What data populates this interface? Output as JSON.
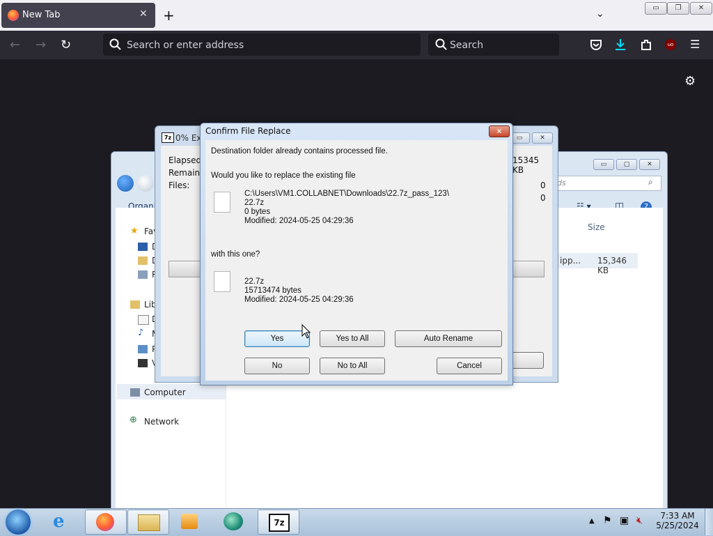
{
  "browser": {
    "tab_title": "New Tab",
    "tab_close": "✕",
    "new_tab": "+",
    "tab_list": "⌄",
    "url_placeholder": "Search or enter address",
    "search_placeholder": "Search",
    "window_buttons": [
      "▭",
      "❐",
      "✕"
    ]
  },
  "explorer": {
    "organize": "Organiz",
    "search_placeholder": "ds",
    "size_header": "Size",
    "file_partial": "ipp...",
    "file_size": "15,346 KB",
    "sidebar": [
      {
        "label": "Fav"
      },
      {
        "label": "D"
      },
      {
        "label": "D"
      },
      {
        "label": "R"
      },
      {
        "label": "Lib"
      },
      {
        "label": "D"
      },
      {
        "label": "M"
      },
      {
        "label": "P"
      },
      {
        "label": "V"
      },
      {
        "label": "Computer"
      },
      {
        "label": "Network"
      }
    ]
  },
  "sevenzip": {
    "title": "0% Ext",
    "elapsed_label": "Elapsed ti",
    "remaining_label": "Remaining",
    "files_label": "Files:",
    "size_value": "15345 KB",
    "value1": "0",
    "value2": "0"
  },
  "dialog": {
    "title": "Confirm File Replace",
    "close": "✕",
    "msg1": "Destination folder already contains processed file.",
    "msg2": "Would you like to replace the existing file",
    "existing": {
      "path": "C:\\Users\\VM1.COLLABNET\\Downloads\\22.7z_pass_123\\",
      "name": "22.7z",
      "size": "0 bytes",
      "modified": "Modified: 2024-05-25 04:29:36"
    },
    "with_this": "with this one?",
    "new": {
      "name": "22.7z",
      "size": "15713474 bytes",
      "modified": "Modified: 2024-05-25 04:29:36"
    },
    "buttons": {
      "yes": "Yes",
      "yes_all": "Yes to All",
      "auto_rename": "Auto Rename",
      "no": "No",
      "no_all": "No to All",
      "cancel": "Cancel"
    }
  },
  "taskbar": {
    "time": "7:33 AM",
    "date": "5/25/2024",
    "sevenzip_icon": "7z"
  }
}
